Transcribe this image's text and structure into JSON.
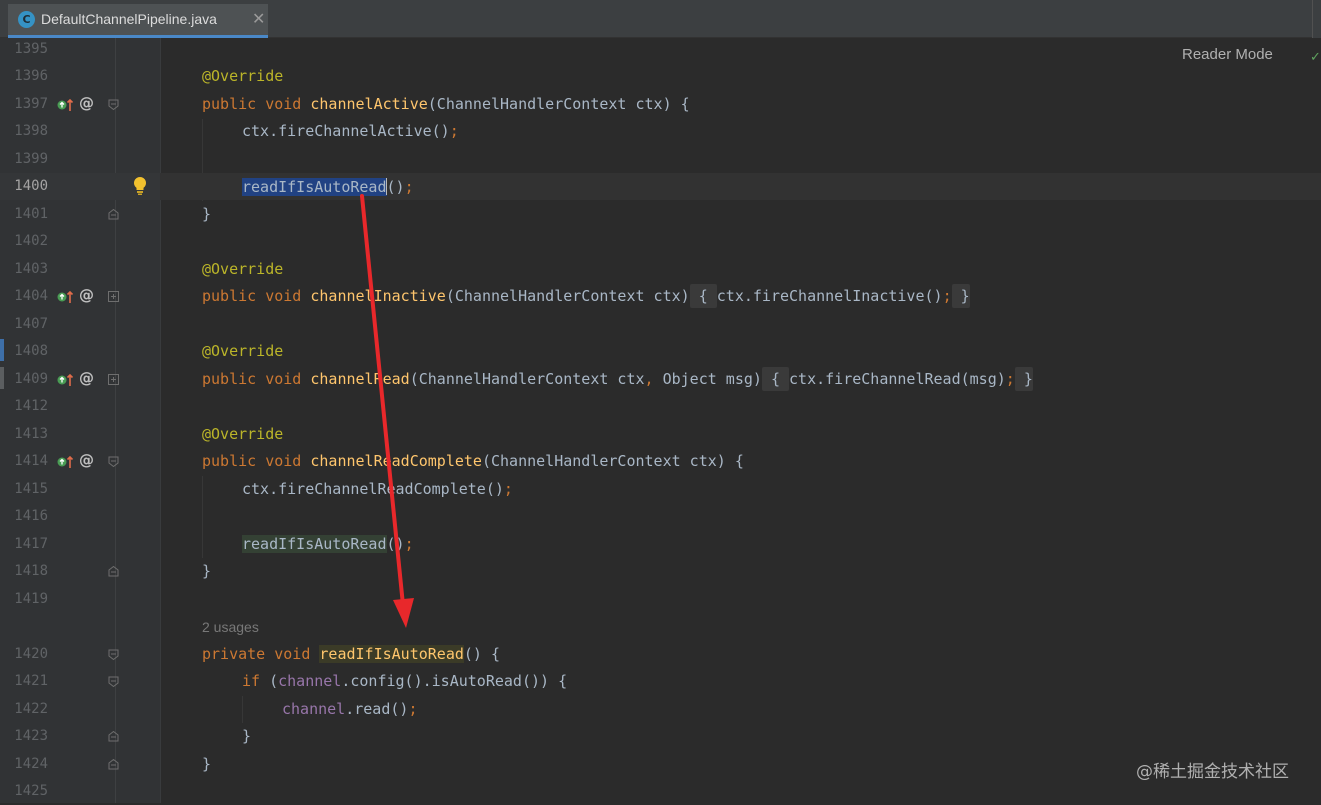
{
  "tab": {
    "icon_letter": "C",
    "label": "DefaultChannelPipeline.java",
    "close": "✕"
  },
  "editor": {
    "reader_mode_label": "Reader Mode",
    "inspection_status": "✓",
    "usages_hint": "2 usages",
    "line_numbers": [
      "1395",
      "1396",
      "1397",
      "1398",
      "1399",
      "1400",
      "1401",
      "1402",
      "1403",
      "1404",
      "1407",
      "1408",
      "1409",
      "1412",
      "1413",
      "1414",
      "1415",
      "1416",
      "1417",
      "1418",
      "1419",
      "1420",
      "1421",
      "1422",
      "1423",
      "1424",
      "1425"
    ],
    "current_line": "1400"
  },
  "code": {
    "l1396": "@Override",
    "l1397_kw": "public void ",
    "l1397_fn": "channelActive",
    "l1397_rest": "(ChannelHandlerContext ctx) {",
    "l1398_a": "ctx.fireChannelActive()",
    "l1398_b": ";",
    "l1400_sel": "readIfIsAutoRead",
    "l1400_rest": "()",
    "l1400_semi": ";",
    "l1401": "}",
    "l1403": "@Override",
    "l1404_kw": "public void ",
    "l1404_fn": "channelInactive",
    "l1404_rest": "(ChannelHandlerContext ctx)",
    "l1404_open": " { ",
    "l1404_body": "ctx.fireChannelInactive()",
    "l1404_semi": ";",
    "l1404_close": " }",
    "l1408": "@Override",
    "l1409_kw": "public void ",
    "l1409_fn": "channelRead",
    "l1409_rest_a": "(ChannelHandlerContext ctx",
    "l1409_comma": ", ",
    "l1409_rest_b": "Object msg)",
    "l1409_open": " { ",
    "l1409_body": "ctx.fireChannelRead(msg)",
    "l1409_semi": ";",
    "l1409_close": " }",
    "l1413": "@Override",
    "l1414_kw": "public void ",
    "l1414_fn": "channelReadComplete",
    "l1414_rest": "(ChannelHandlerContext ctx) {",
    "l1415_a": "ctx.fireChannelReadComplete()",
    "l1415_b": ";",
    "l1417_hl": "readIfIsAutoRead",
    "l1417_rest": "()",
    "l1417_semi": ";",
    "l1418": "}",
    "l1420_kw": "private void ",
    "l1420_fn": "readIfIsAutoRead",
    "l1420_rest": "() {",
    "l1421_kw": "if ",
    "l1421_open": "(",
    "l1421_fld": "channel",
    "l1421_rest": ".config().isAutoRead()) {",
    "l1422_fld": "channel",
    "l1422_rest": ".read()",
    "l1422_semi": ";",
    "l1423": "}",
    "l1424": "}"
  },
  "watermark": "@稀土掘金技术社区",
  "colors": {
    "editor_bg": "#2b2b2b",
    "gutter_bg": "#313335",
    "keyword": "#cc7832",
    "annotation": "#bbb529",
    "method_decl": "#ffc66d",
    "field": "#9876aa",
    "text": "#a9b7c6",
    "selection": "#214283",
    "arrow": "#e8282b"
  },
  "icons": {
    "tab_icon": "java-class-icon",
    "implements": "implementing-method-icon",
    "override_at": "at-sign-icon",
    "fold": "fold-marker-icon",
    "bulb": "lightbulb-icon"
  }
}
